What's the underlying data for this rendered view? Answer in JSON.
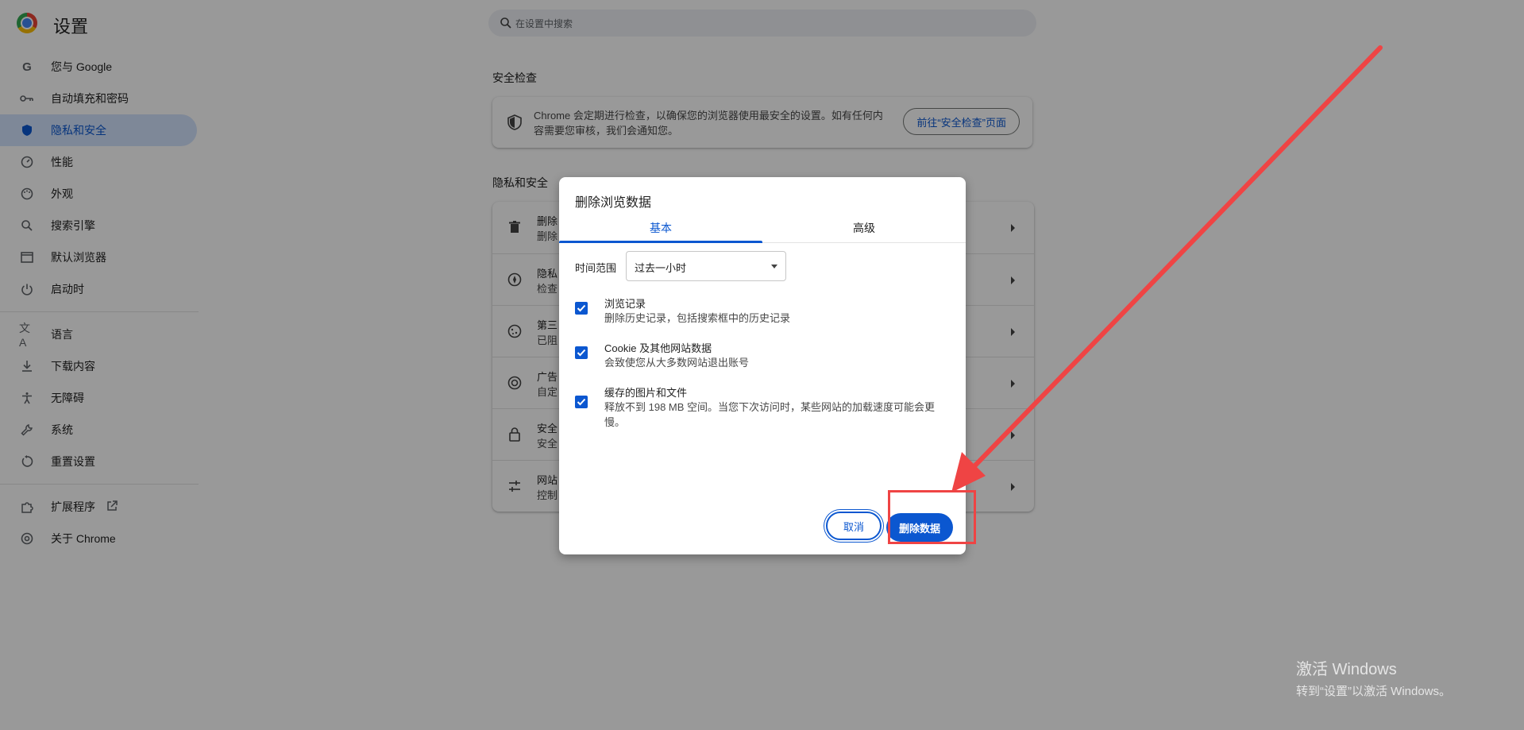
{
  "header": {
    "title": "设置",
    "search_placeholder": "在设置中搜索"
  },
  "sidebar": {
    "items": [
      {
        "label": "您与 Google",
        "icon": "google-g-icon"
      },
      {
        "label": "自动填充和密码",
        "icon": "key-icon"
      },
      {
        "label": "隐私和安全",
        "icon": "shield-icon",
        "active": true
      },
      {
        "label": "性能",
        "icon": "gauge-icon"
      },
      {
        "label": "外观",
        "icon": "palette-icon"
      },
      {
        "label": "搜索引擎",
        "icon": "search-icon"
      },
      {
        "label": "默认浏览器",
        "icon": "browser-window-icon"
      },
      {
        "label": "启动时",
        "icon": "power-icon"
      },
      {
        "label": "语言",
        "icon": "translate-icon"
      },
      {
        "label": "下载内容",
        "icon": "download-icon"
      },
      {
        "label": "无障碍",
        "icon": "accessibility-icon"
      },
      {
        "label": "系统",
        "icon": "wrench-icon"
      },
      {
        "label": "重置设置",
        "icon": "reset-icon"
      },
      {
        "label": "扩展程序",
        "icon": "puzzle-icon"
      },
      {
        "label": "关于 Chrome",
        "icon": "chrome-icon"
      }
    ]
  },
  "safety_check": {
    "heading": "安全检查",
    "text": "Chrome 会定期进行检查，以确保您的浏览器使用最安全的设置。如有任何内容需要您审核，我们会通知您。",
    "button": "前往“安全检查”页面"
  },
  "privacy": {
    "heading": "隐私和安全",
    "rows": [
      {
        "title": "删除",
        "sub": "删除",
        "icon": "trash-icon"
      },
      {
        "title": "隐私",
        "sub": "检查",
        "icon": "compass-icon"
      },
      {
        "title": "第三",
        "sub": "已阻",
        "icon": "cookie-icon"
      },
      {
        "title": "广告",
        "sub": "自定",
        "icon": "ad-target-icon"
      },
      {
        "title": "安全",
        "sub": "安全",
        "icon": "lock-icon"
      },
      {
        "title": "网站",
        "sub": "控制",
        "icon": "sliders-icon"
      }
    ]
  },
  "dialog": {
    "title": "删除浏览数据",
    "tabs": [
      "基本",
      "高级"
    ],
    "time_range_label": "时间范围",
    "time_range_value": "过去一小时",
    "options": [
      {
        "title": "浏览记录",
        "sub": "删除历史记录，包括搜索框中的历史记录",
        "checked": true
      },
      {
        "title": "Cookie 及其他网站数据",
        "sub": "会致使您从大多数网站退出账号",
        "checked": true
      },
      {
        "title": "缓存的图片和文件",
        "sub": "释放不到 198 MB 空间。当您下次访问时，某些网站的加载速度可能会更慢。",
        "checked": true
      }
    ],
    "cancel": "取消",
    "delete": "删除数据"
  },
  "watermark": {
    "line1": "激活 Windows",
    "line2": "转到“设置”以激活 Windows。"
  },
  "colors": {
    "accent": "#0b57d0",
    "annotation": "#ef4444"
  }
}
